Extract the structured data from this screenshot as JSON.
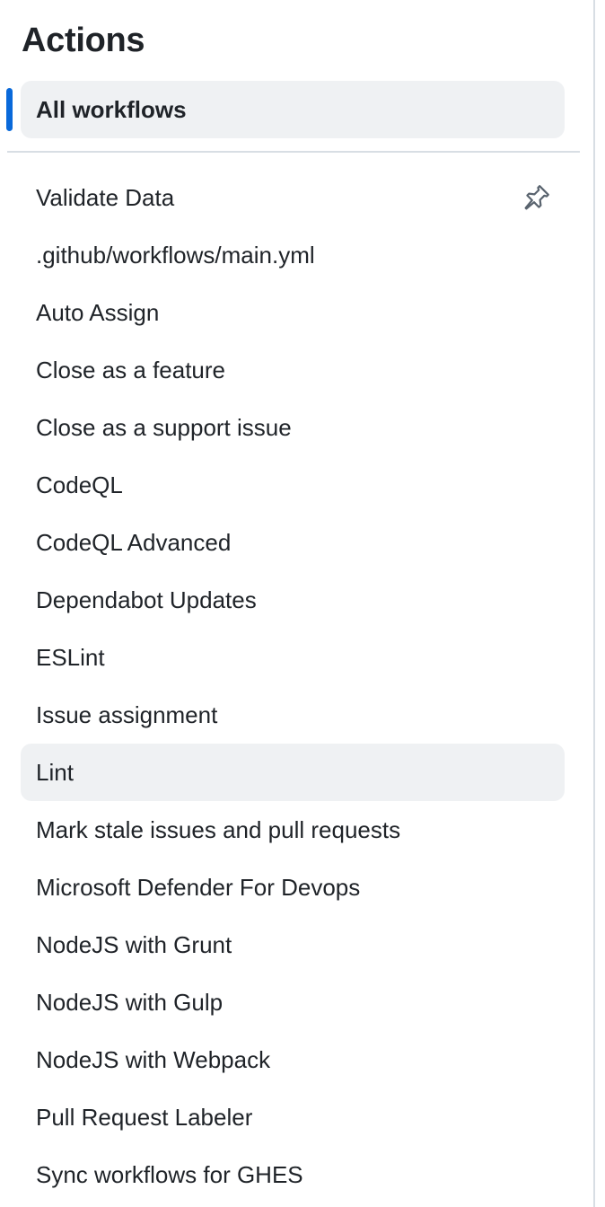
{
  "sidebar": {
    "title": "Actions",
    "all_workflows_label": "All workflows",
    "pin_icon": "pin-icon",
    "workflows": [
      {
        "label": "Validate Data",
        "pinnable": true
      },
      {
        "label": ".github/workflows/main.yml"
      },
      {
        "label": "Auto Assign"
      },
      {
        "label": "Close as a feature"
      },
      {
        "label": "Close as a support issue"
      },
      {
        "label": "CodeQL"
      },
      {
        "label": "CodeQL Advanced"
      },
      {
        "label": "Dependabot Updates"
      },
      {
        "label": "ESLint"
      },
      {
        "label": "Issue assignment"
      },
      {
        "label": "Lint",
        "hovered": true
      },
      {
        "label": "Mark stale issues and pull requests"
      },
      {
        "label": "Microsoft Defender For Devops"
      },
      {
        "label": "NodeJS with Grunt"
      },
      {
        "label": "NodeJS with Gulp"
      },
      {
        "label": "NodeJS with Webpack"
      },
      {
        "label": "Pull Request Labeler"
      },
      {
        "label": "Sync workflows for GHES"
      }
    ]
  },
  "colors": {
    "accent": "#0969da",
    "selected_bg": "#eff1f3",
    "text": "#1f2328",
    "border": "#d8dee4",
    "icon": "#59636e"
  }
}
